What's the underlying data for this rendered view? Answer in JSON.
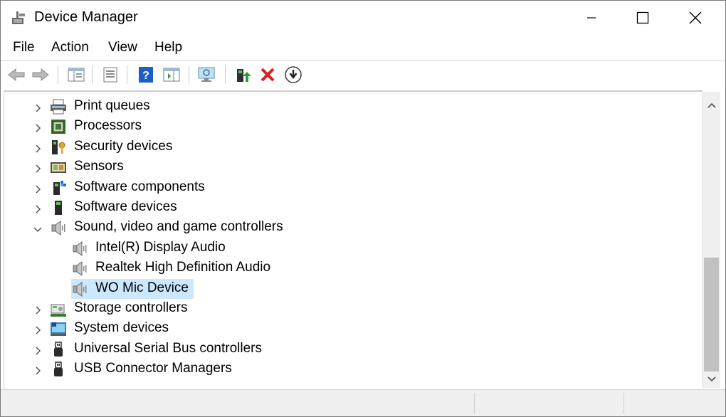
{
  "window": {
    "title": "Device Manager",
    "min_icon": "minimize-icon",
    "max_icon": "maximize-icon",
    "close_icon": "close-icon"
  },
  "menu": [
    {
      "label": "File"
    },
    {
      "label": "Action"
    },
    {
      "label": "View"
    },
    {
      "label": "Help"
    }
  ],
  "toolbar": [
    "back-arrow-icon",
    "forward-arrow-icon",
    "show-hide-console-tree-icon",
    "properties-icon",
    "help-icon",
    "action-pane-icon",
    "scan-hardware-icon",
    "update-driver-icon",
    "uninstall-device-icon",
    "disable-device-icon"
  ],
  "tree": [
    {
      "label": "Print queues",
      "icon": "printer-icon",
      "level": 0,
      "state": "collapsed"
    },
    {
      "label": "Processors",
      "icon": "processor-chip-icon",
      "level": 0,
      "state": "collapsed"
    },
    {
      "label": "Security devices",
      "icon": "security-key-icon",
      "level": 0,
      "state": "collapsed"
    },
    {
      "label": "Sensors",
      "icon": "sensor-icon",
      "level": 0,
      "state": "collapsed"
    },
    {
      "label": "Software components",
      "icon": "software-component-icon",
      "level": 0,
      "state": "collapsed"
    },
    {
      "label": "Software devices",
      "icon": "software-device-icon",
      "level": 0,
      "state": "collapsed"
    },
    {
      "label": "Sound, video and game controllers",
      "icon": "speaker-icon",
      "level": 0,
      "state": "expanded"
    },
    {
      "label": "Intel(R) Display Audio",
      "icon": "speaker-icon",
      "level": 1,
      "state": "leaf"
    },
    {
      "label": "Realtek High Definition Audio",
      "icon": "speaker-icon",
      "level": 1,
      "state": "leaf"
    },
    {
      "label": "WO Mic Device",
      "icon": "speaker-icon",
      "level": 1,
      "state": "leaf",
      "selected": true
    },
    {
      "label": "Storage controllers",
      "icon": "storage-controller-icon",
      "level": 0,
      "state": "collapsed"
    },
    {
      "label": "System devices",
      "icon": "system-device-icon",
      "level": 0,
      "state": "collapsed"
    },
    {
      "label": "Universal Serial Bus controllers",
      "icon": "usb-icon",
      "level": 0,
      "state": "collapsed"
    },
    {
      "label": "USB Connector Managers",
      "icon": "usb-icon",
      "level": 0,
      "state": "collapsed"
    }
  ],
  "colors": {
    "selection": "#cce8ff",
    "accent_blue": "#1c6fd1",
    "delete_red": "#e21b1b",
    "green": "#2e9a3a"
  }
}
